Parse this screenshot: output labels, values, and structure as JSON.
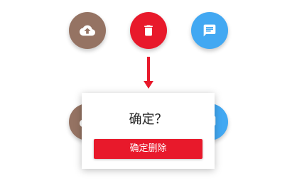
{
  "colors": {
    "upload": "#957363",
    "delete": "#e8192b",
    "message": "#42a8f2",
    "arrow": "#e8192b",
    "confirm_button": "#e8192b"
  },
  "fabs": [
    {
      "icon": "cloud-upload-icon",
      "color": "#957363"
    },
    {
      "icon": "trash-icon",
      "color": "#e8192b"
    },
    {
      "icon": "message-icon",
      "color": "#42a8f2"
    }
  ],
  "popup": {
    "title": "确定？",
    "confirm_label": "确定删除"
  }
}
